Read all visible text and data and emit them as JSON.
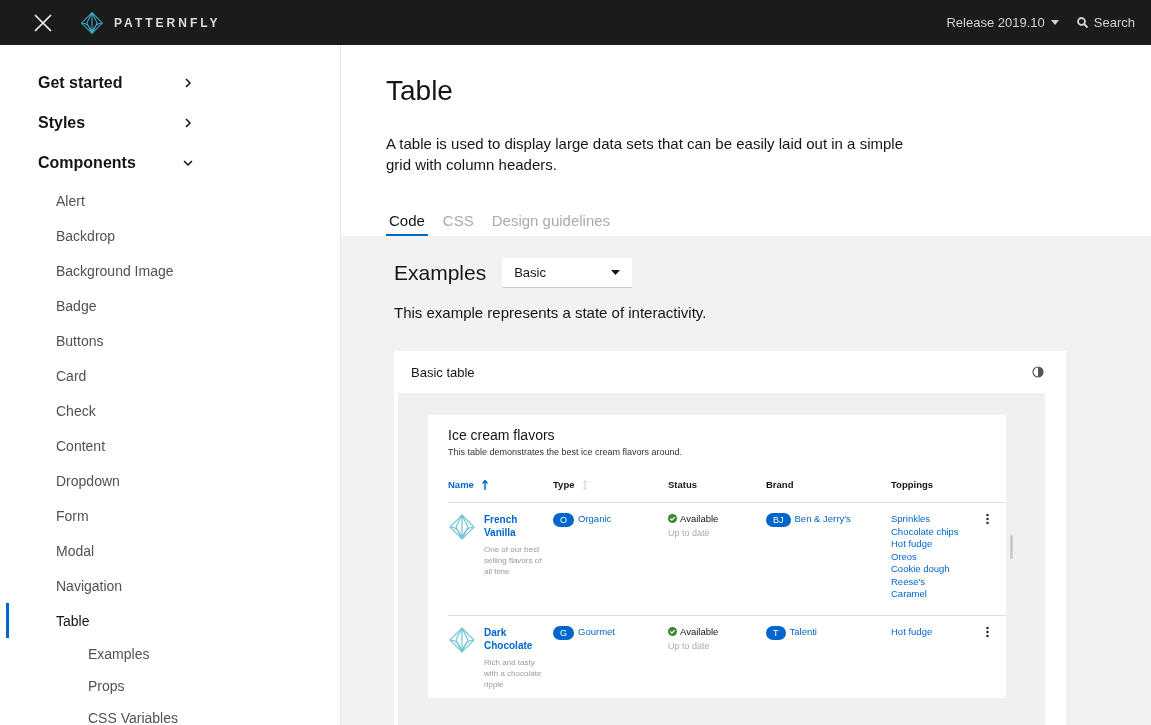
{
  "header": {
    "logo_text": "PATTERNFLY",
    "release": "Release 2019.10",
    "search": "Search"
  },
  "sidebar": {
    "items": [
      {
        "label": "Get started",
        "expanded": false
      },
      {
        "label": "Styles",
        "expanded": false
      },
      {
        "label": "Components",
        "expanded": true,
        "children": [
          {
            "label": "Alert",
            "selected": false
          },
          {
            "label": "Backdrop",
            "selected": false
          },
          {
            "label": "Background Image",
            "selected": false
          },
          {
            "label": "Badge",
            "selected": false
          },
          {
            "label": "Buttons",
            "selected": false
          },
          {
            "label": "Card",
            "selected": false
          },
          {
            "label": "Check",
            "selected": false
          },
          {
            "label": "Content",
            "selected": false
          },
          {
            "label": "Dropdown",
            "selected": false
          },
          {
            "label": "Form",
            "selected": false
          },
          {
            "label": "Modal",
            "selected": false
          },
          {
            "label": "Navigation",
            "selected": false
          },
          {
            "label": "Table",
            "selected": true,
            "children": [
              {
                "label": "Examples"
              },
              {
                "label": "Props"
              },
              {
                "label": "CSS Variables"
              }
            ]
          }
        ]
      }
    ]
  },
  "page": {
    "title": "Table",
    "description": "A table is used to display large data sets that can be easily laid out in a simple grid with column headers.",
    "tabs": [
      {
        "label": "Code",
        "selected": true
      },
      {
        "label": "CSS",
        "selected": false
      },
      {
        "label": "Design guidelines",
        "selected": false
      }
    ]
  },
  "examples": {
    "label": "Examples",
    "select_value": "Basic",
    "description": "This example represents a state of interactivity."
  },
  "example_card": {
    "title": "Basic table",
    "table": {
      "title": "Ice cream flavors",
      "description": "This table demonstrates the best ice cream flavors around.",
      "columns": [
        {
          "label": "Name",
          "sortable": true,
          "sorted": true
        },
        {
          "label": "Type",
          "sortable": true,
          "sorted": false
        },
        {
          "label": "Status",
          "sortable": false,
          "sorted": false
        },
        {
          "label": "Brand",
          "sortable": false,
          "sorted": false
        },
        {
          "label": "Toppings",
          "sortable": false,
          "sorted": false
        }
      ],
      "rows": [
        {
          "name": "French Vanilla",
          "description": "One of our best selling flavors of all time",
          "type_badge": "O",
          "type": "Organic",
          "status": "Available",
          "status_detail": "Up to date",
          "brand_badge": "BJ",
          "brand": "Ben & Jerry's",
          "toppings": [
            "Sprinkles",
            "Chocolate chips",
            "Hot fudge",
            "Oreos",
            "Cookie dough",
            "Reese's",
            "Caramel"
          ]
        },
        {
          "name": "Dark Chocolate",
          "description": "Rich and tasty with a chocolate ripple",
          "type_badge": "G",
          "type": "Gourmet",
          "status": "Available",
          "status_detail": "Up to date",
          "brand_badge": "T",
          "brand": "Talenti",
          "toppings": [
            "Hot fudge"
          ]
        }
      ]
    }
  }
}
